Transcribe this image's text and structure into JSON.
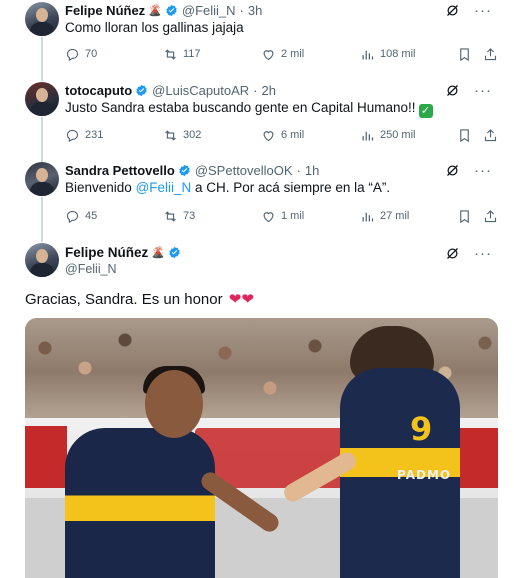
{
  "tweets": [
    {
      "name": "Felipe Núñez",
      "handle": "@Felii_N",
      "time": "3h",
      "text": "Como lloran los gallinas jajaja",
      "replies": "70",
      "retweets": "117",
      "likes": "2 mil",
      "views": "108 mil"
    },
    {
      "name": "totocaputo",
      "handle": "@LuisCaputoAR",
      "time": "2h",
      "text": "Justo Sandra estaba buscando gente en Capital Humano!!",
      "replies": "231",
      "retweets": "302",
      "likes": "6 mil",
      "views": "250 mil"
    },
    {
      "name": "Sandra Pettovello",
      "handle": "@SPettovelloOK",
      "time": "1h",
      "text_before": "Bienvenido ",
      "mention": "@Felii_N",
      "text_after": " a CH. Por acá siempre en la “A”.",
      "replies": "45",
      "retweets": "73",
      "likes": "1 mil",
      "views": "27 mil"
    }
  ],
  "main_tweet": {
    "name": "Felipe Núñez",
    "handle": "@Felii_N",
    "text": "Gracias, Sandra. Es un honor",
    "hearts": "❤❤"
  },
  "photo": {
    "jersey_number": "9",
    "jersey_name": "PADMO"
  },
  "icons": {
    "verified": "verified-badge-icon",
    "grok": "grok-icon",
    "more": "more-icon",
    "reply": "reply-icon",
    "retweet": "retweet-icon",
    "like": "like-icon",
    "views": "views-icon",
    "bookmark": "bookmark-icon",
    "share": "share-icon"
  },
  "colors": {
    "accent": "#1d9bf0",
    "text_secondary": "#536471",
    "heart": "#e0245e"
  }
}
